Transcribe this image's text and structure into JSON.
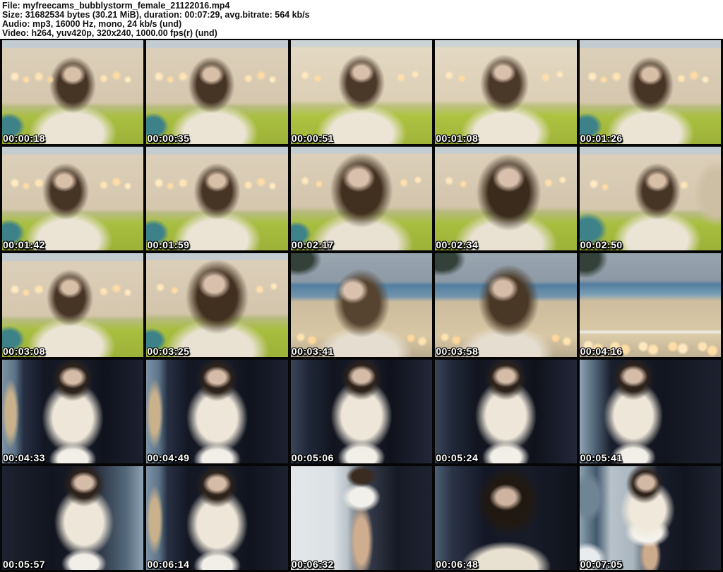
{
  "header": {
    "file_line": "File: myfreecams_bubblystorm_female_21122016.mp4",
    "size_line": "Size: 31682534 bytes (30.21 MiB), duration: 00:07:29, avg.bitrate: 564 kb/s",
    "audio_line": "Audio: mp3, 16000 Hz, mono, 24 kb/s (und)",
    "video_line": "Video: h264, yuv420p, 320x240, 1000.00 fps(r) (und)"
  },
  "colors": {
    "page_bg": "#ffffff",
    "grid_bg": "#060606",
    "timestamp_text": "#ffffff",
    "timestamp_outline": "#000000"
  },
  "thumbnails": [
    {
      "t": "00:00:18",
      "bg": "background:radial-gradient(circle 10px at 9% 35%,#ffeac2 30%,transparent 75%),radial-gradient(circle 8px at 17% 38%,#ffdca4 30%,transparent 75%),radial-gradient(circle 10px at 26% 35%,#ffe5b5 30%,transparent 75%),radial-gradient(circle 8px at 34% 38%,#f5d6a0 30%,transparent 75%),radial-gradient(circle 9px at 72% 37%,#ffe5b5 30%,transparent 75%),radial-gradient(circle 10px at 81% 34%,#ffdca4 30%,transparent 75%),radial-gradient(circle 8px at 89% 38%,#ffeac2 30%,transparent 75%),radial-gradient(ellipse 24px 20px at 50% 33%,#d8bfa8 45%,transparent 78%),radial-gradient(ellipse 46px 56px at 50% 43%,#463425 45%,transparent 72%),radial-gradient(ellipse 78px 52px at 50% 90%,#ebe4d5 55%,transparent 80%),radial-gradient(ellipse 28px 24px at 5% 83%,#3d8189 50%,transparent 80%),linear-gradient(180deg,#c3ccd1 0%,#c3ccd1 7%,#dccfb9 8%,#d5c7ae 60%,#b8bc80 64%,#a9bf40 74%,#9cb138 100%)"
    },
    {
      "t": "00:00:35",
      "bg": "background:radial-gradient(circle 10px at 9% 35%,#ffeac2 30%,transparent 75%),radial-gradient(circle 8px at 17% 38%,#ffdca4 30%,transparent 75%),radial-gradient(circle 10px at 26% 35%,#ffe5b5 30%,transparent 75%),radial-gradient(circle 9px at 72% 37%,#ffe5b5 30%,transparent 75%),radial-gradient(circle 10px at 81% 34%,#ffdca4 30%,transparent 75%),radial-gradient(circle 8px at 89% 38%,#ffeac2 30%,transparent 75%),radial-gradient(ellipse 24px 20px at 46% 33%,#d8bfa8 45%,transparent 78%),radial-gradient(ellipse 46px 56px at 46% 43%,#463425 45%,transparent 72%),radial-gradient(ellipse 78px 52px at 48% 90%,#ebe4d5 55%,transparent 80%),radial-gradient(ellipse 28px 24px at 5% 83%,#3d8189 50%,transparent 80%),linear-gradient(180deg,#c3ccd1 0%,#c3ccd1 7%,#dccfb9 8%,#d5c7ae 60%,#b8bc80 64%,#a9bf40 74%,#9cb138 100%)"
    },
    {
      "t": "00:00:51",
      "bg": "background:radial-gradient(circle 9px at 10% 34%,#ffe8bd 30%,transparent 75%),radial-gradient(circle 8px at 19% 37%,#ffdca4 30%,transparent 75%),radial-gradient(circle 9px at 78% 36%,#ffe0ac 30%,transparent 75%),radial-gradient(circle 8px at 88% 33%,#ffe8bd 30%,transparent 75%),radial-gradient(ellipse 24px 20px at 50% 31%,#d9c0ac 45%,transparent 78%),radial-gradient(ellipse 46px 56px at 50% 41%,#4a3828 45%,transparent 72%),radial-gradient(ellipse 80px 52px at 50% 90%,#ece5d6 55%,transparent 80%),linear-gradient(180deg,#cdd4d6 0%,#cdd4d6 6%,#e3d8c2 7%,#dccfb6 58%,#bec183 63%,#aec340 73%,#a0b43a 100%)"
    },
    {
      "t": "00:01:08",
      "bg": "background:radial-gradient(circle 9px at 10% 34%,#ffe8bd 30%,transparent 75%),radial-gradient(circle 8px at 19% 37%,#ffdca4 30%,transparent 75%),radial-gradient(circle 9px at 78% 36%,#ffe0ac 30%,transparent 75%),radial-gradient(circle 8px at 88% 33%,#ffe8bd 30%,transparent 75%),radial-gradient(ellipse 24px 20px at 48% 31%,#d9c0ac 45%,transparent 78%),radial-gradient(ellipse 48px 58px at 49% 42%,#4a3828 45%,transparent 72%),radial-gradient(ellipse 80px 52px at 50% 90%,#ece5d6 55%,transparent 80%),linear-gradient(180deg,#cdd4d6 0%,#cdd4d6 6%,#e3d8c2 7%,#dccfb6 58%,#bec183 63%,#aec340 73%,#a0b43a 100%)"
    },
    {
      "t": "00:01:26",
      "bg": "background:radial-gradient(circle 10px at 9% 35%,#ffeac2 30%,transparent 75%),radial-gradient(circle 8px at 17% 38%,#ffdca4 30%,transparent 75%),radial-gradient(circle 10px at 26% 35%,#ffe5b5 30%,transparent 75%),radial-gradient(circle 9px at 72% 37%,#ffe5b5 30%,transparent 75%),radial-gradient(circle 10px at 81% 34%,#ffdca4 30%,transparent 75%),radial-gradient(circle 8px at 89% 38%,#ffeac2 30%,transparent 75%),radial-gradient(ellipse 24px 20px at 50% 33%,#d8bfa8 45%,transparent 78%),radial-gradient(ellipse 46px 56px at 50% 43%,#463425 45%,transparent 72%),radial-gradient(ellipse 78px 52px at 50% 90%,#ebe4d5 55%,transparent 80%),radial-gradient(ellipse 28px 24px at 5% 83%,#3d8189 50%,transparent 80%),linear-gradient(180deg,#c3ccd1 0%,#c3ccd1 7%,#dccfb9 8%,#d5c7ae 60%,#b8bc80 64%,#a9bf40 74%,#9cb138 100%)"
    },
    {
      "t": "00:01:42",
      "bg": "background:radial-gradient(circle 10px at 9% 35%,#ffeac2 30%,transparent 75%),radial-gradient(circle 8px at 17% 38%,#ffdca4 30%,transparent 75%),radial-gradient(circle 10px at 26% 35%,#ffe5b5 30%,transparent 75%),radial-gradient(circle 9px at 72% 37%,#ffe5b5 30%,transparent 75%),radial-gradient(circle 10px at 81% 34%,#ffdca4 30%,transparent 75%),radial-gradient(circle 8px at 89% 38%,#ffeac2 30%,transparent 75%),radial-gradient(ellipse 24px 20px at 44% 33%,#d8bfa8 45%,transparent 78%),radial-gradient(ellipse 46px 56px at 45% 43%,#463425 45%,transparent 72%),radial-gradient(ellipse 78px 52px at 47% 90%,#ebe4d5 55%,transparent 80%),radial-gradient(ellipse 28px 24px at 5% 83%,#3d8189 50%,transparent 80%),linear-gradient(180deg,#c3ccd1 0%,#c3ccd1 7%,#dccfb9 8%,#d5c7ae 60%,#b8bc80 64%,#a9bf40 74%,#9cb138 100%)"
    },
    {
      "t": "00:01:59",
      "bg": "background:radial-gradient(circle 10px at 9% 35%,#ffeac2 30%,transparent 75%),radial-gradient(circle 8px at 17% 38%,#ffdca4 30%,transparent 75%),radial-gradient(circle 10px at 26% 35%,#ffe5b5 30%,transparent 75%),radial-gradient(circle 9px at 72% 37%,#ffe5b5 30%,transparent 75%),radial-gradient(circle 10px at 81% 34%,#ffdca4 30%,transparent 75%),radial-gradient(circle 8px at 89% 38%,#ffeac2 30%,transparent 75%),radial-gradient(ellipse 24px 20px at 50% 33%,#d8bfa8 45%,transparent 78%),radial-gradient(ellipse 46px 56px at 50% 43%,#463425 45%,transparent 72%),radial-gradient(ellipse 78px 52px at 50% 90%,#ebe4d5 55%,transparent 80%),radial-gradient(ellipse 28px 24px at 5% 83%,#3d8189 50%,transparent 80%),linear-gradient(180deg,#c3ccd1 0%,#c3ccd1 7%,#dccfb9 8%,#d5c7ae 60%,#b8bc80 64%,#a9bf40 74%,#9cb138 100%)"
    },
    {
      "t": "00:02:17",
      "bg": "background:radial-gradient(circle 9px at 10% 33%,#ffe8bd 30%,transparent 75%),radial-gradient(circle 8px at 20% 36%,#ffdca4 30%,transparent 75%),radial-gradient(circle 9px at 80% 35%,#ffe0ac 30%,transparent 75%),radial-gradient(circle 8px at 90% 32%,#ffe8bd 30%,transparent 75%),radial-gradient(ellipse 30px 26px at 48% 30%,#d9c0ac 45%,transparent 78%),radial-gradient(ellipse 62px 74px at 50% 42%,#41301f 45%,transparent 72%),radial-gradient(ellipse 92px 58px at 50% 94%,#e9e2d3 55%,transparent 80%),radial-gradient(ellipse 26px 22px at 4% 84%,#3d8189 50%,transparent 80%),linear-gradient(180deg,#c3ccd1 0%,#c3ccd1 6%,#dccfb9 7%,#d3c5ac 58%,#b5ba7c 63%,#a8be3f 74%,#9cb138 100%)"
    },
    {
      "t": "00:02:34",
      "bg": "background:radial-gradient(circle 9px at 10% 33%,#ffe8bd 30%,transparent 75%),radial-gradient(circle 8px at 20% 36%,#ffdca4 30%,transparent 75%),radial-gradient(circle 9px at 80% 35%,#ffe0ac 30%,transparent 75%),radial-gradient(circle 8px at 90% 32%,#ffe8bd 30%,transparent 75%),radial-gradient(ellipse 30px 26px at 52% 30%,#d9c0ac 45%,transparent 78%),radial-gradient(ellipse 64px 76px at 52% 44%,#3a2b1c 45%,transparent 72%),radial-gradient(ellipse 92px 58px at 50% 94%,#e9e2d3 55%,transparent 80%),linear-gradient(180deg,#c3ccd1 0%,#c3ccd1 6%,#dccfb9 7%,#d3c5ac 58%,#b5ba7c 63%,#a8be3f 74%,#9cb138 100%)"
    },
    {
      "t": "00:02:50",
      "bg": "background:radial-gradient(circle 10px at 10% 36%,#ffeac2 30%,transparent 75%),radial-gradient(circle 8px at 18% 39%,#ffdca4 30%,transparent 75%),radial-gradient(circle 9px at 74% 37%,#ffe5b5 30%,transparent 75%),radial-gradient(ellipse 24px 20px at 55% 33%,#d8bfa8 45%,transparent 78%),radial-gradient(ellipse 46px 56px at 55% 43%,#463425 45%,transparent 72%),radial-gradient(ellipse 78px 52px at 55% 90%,#ebe4d5 55%,transparent 80%),radial-gradient(ellipse 34px 30px at 6% 80%,#3d8189 50%,transparent 80%),radial-gradient(ellipse 40px 60px at 97% 45%,#cdbfa4 50%,transparent 80%),linear-gradient(180deg,#c3ccd1 0%,#c3ccd1 7%,#dccfb9 8%,#d5c7ae 60%,#b8bc80 64%,#a9bf40 74%,#9cb138 100%)"
    },
    {
      "t": "00:03:08",
      "bg": "background:radial-gradient(circle 10px at 9% 35%,#ffeac2 30%,transparent 75%),radial-gradient(circle 8px at 17% 38%,#ffdca4 30%,transparent 75%),radial-gradient(circle 10px at 26% 35%,#ffe5b5 30%,transparent 75%),radial-gradient(circle 9px at 72% 37%,#ffe5b5 30%,transparent 75%),radial-gradient(circle 10px at 81% 34%,#ffdca4 30%,transparent 75%),radial-gradient(circle 8px at 89% 38%,#ffeac2 30%,transparent 75%),radial-gradient(ellipse 24px 20px at 48% 33%,#d8bfa8 45%,transparent 78%),radial-gradient(ellipse 46px 56px at 48% 43%,#463425 45%,transparent 72%),radial-gradient(ellipse 78px 52px at 49% 90%,#ebe4d5 55%,transparent 80%),radial-gradient(ellipse 28px 24px at 5% 83%,#3d8189 50%,transparent 80%),linear-gradient(180deg,#c3ccd1 0%,#c3ccd1 7%,#dccfb9 8%,#d5c7ae 60%,#b8bc80 64%,#a9bf40 74%,#9cb138 100%)"
    },
    {
      "t": "00:03:25",
      "bg": "background:radial-gradient(circle 9px at 10% 33%,#ffe8bd 30%,transparent 75%),radial-gradient(circle 8px at 20% 36%,#ffdca4 30%,transparent 75%),radial-gradient(circle 9px at 80% 35%,#ffe0ac 30%,transparent 75%),radial-gradient(circle 8px at 90% 32%,#ffe8bd 30%,transparent 75%),radial-gradient(ellipse 30px 26px at 48% 30%,#d9c0ac 45%,transparent 78%),radial-gradient(ellipse 62px 74px at 50% 42%,#41301f 45%,transparent 72%),radial-gradient(ellipse 92px 58px at 50% 94%,#e9e2d3 55%,transparent 80%),radial-gradient(ellipse 26px 22px at 4% 84%,#3d8189 50%,transparent 80%),linear-gradient(180deg,#c3ccd1 0%,#c3ccd1 6%,#dccfb9 7%,#d3c5ac 58%,#b5ba7c 63%,#a8be3f 74%,#9cb138 100%)"
    },
    {
      "t": "00:03:41",
      "bg": "background:radial-gradient(circle 9px at 7% 81%,#ffe3b0 35%,transparent 75%),radial-gradient(circle 10px at 15% 84%,#ffd79a 35%,transparent 75%),radial-gradient(circle 9px at 85% 82%,#ffd79a 35%,transparent 75%),radial-gradient(circle 10px at 93% 85%,#ffe3b0 35%,transparent 75%),radial-gradient(ellipse 28px 24px at 44% 36%,#d9c1ae 45%,transparent 78%),radial-gradient(ellipse 56px 68px at 50% 48%,#564330 45%,transparent 72%),radial-gradient(ellipse 85px 48px at 52% 96%,#e5ddcf 55%,transparent 80%),radial-gradient(ellipse 42px 30px at 5% 6%,#33413a 50%,transparent 80%),linear-gradient(180deg,#99a5af 0%,#8d9aa6 27%,#527ea0 31%,#7495ad 42%,#ccbc9d 47%,#d8c7a4 80%,#baab8e 100%)"
    },
    {
      "t": "00:03:58",
      "bg": "background:radial-gradient(circle 9px at 7% 81%,#ffe3b0 35%,transparent 75%),radial-gradient(circle 10px at 15% 84%,#ffd79a 35%,transparent 75%),radial-gradient(circle 9px at 85% 82%,#ffd79a 35%,transparent 75%),radial-gradient(circle 10px at 93% 85%,#ffe3b0 35%,transparent 75%),radial-gradient(ellipse 28px 24px at 48% 34%,#d4bca9 45%,transparent 78%),radial-gradient(ellipse 60px 72px at 52% 46%,#4a3826 45%,transparent 72%),radial-gradient(ellipse 85px 48px at 50% 96%,#e5ddcf 55%,transparent 80%),radial-gradient(ellipse 42px 30px at 5% 6%,#33413a 50%,transparent 80%),linear-gradient(180deg,#99a5af 0%,#8d9aa6 27%,#527ea0 31%,#7495ad 42%,#ccbc9d 47%,#d8c7a4 80%,#baab8e 100%)"
    },
    {
      "t": "00:04:16",
      "bg": "background:radial-gradient(circle 11px at 6% 89%,#ffe9c0 40%,transparent 75%),radial-gradient(circle 12px at 13% 92%,#ffdda6 40%,transparent 75%),radial-gradient(circle 11px at 25% 90%,#ffe3b2 40%,transparent 75%),radial-gradient(circle 12px at 32% 93%,#ffdda6 40%,transparent 75%),radial-gradient(circle 11px at 45% 90%,#ffe9c0 40%,transparent 75%),radial-gradient(circle 12px at 52% 93%,#ffe3b2 40%,transparent 75%),radial-gradient(circle 11px at 66% 90%,#ffdda6 40%,transparent 75%),radial-gradient(circle 12px at 73% 92%,#ffe9c0 40%,transparent 75%),radial-gradient(circle 11px at 87% 90%,#ffe3b2 40%,transparent 75%),radial-gradient(circle 12px at 94% 94%,#ffdda6 40%,transparent 75%),linear-gradient(180deg,transparent 74%,#e9e5da 75%,#e9e5da 77%,transparent 78%),radial-gradient(ellipse 40px 35px at 4% 5%,#33413a 50%,transparent 80%),linear-gradient(180deg,#97a3ad 0%,#8c99a5 26%,#527ea0 30%,#7ba0b5 40%,#cdbd9e 46%,#dbcaa7 80%,#c0b194 100%)"
    },
    {
      "t": "00:04:33",
      "bg": "background:radial-gradient(ellipse 26px 20px at 50% 17%,#d5bca9 45%,transparent 78%),radial-gradient(ellipse 40px 42px at 50% 19%,#2e231b 45%,transparent 74%),radial-gradient(ellipse 56px 66px at 50% 56%,#eee7d9 50%,transparent 78%),radial-gradient(ellipse 42px 28px at 50% 96%,#f1efe8 50%,transparent 80%),radial-gradient(ellipse 16px 64px at 6% 52%,#c9b18b 45%,transparent 78%),linear-gradient(90deg,#7d92a5 0%,#5d7488 9%,#273043 15%,#131724 30%,#191d2a 55%,#10131d 72%,#1c2130 100%)"
    },
    {
      "t": "00:04:49",
      "bg": "background:radial-gradient(ellipse 26px 20px at 50% 17%,#d5bca9 45%,transparent 78%),radial-gradient(ellipse 40px 42px at 50% 19%,#2e231b 45%,transparent 74%),radial-gradient(ellipse 56px 66px at 50% 56%,#eee7d9 50%,transparent 78%),radial-gradient(ellipse 42px 28px at 50% 96%,#f1efe8 50%,transparent 80%),radial-gradient(ellipse 16px 64px at 6% 52%,#c9b18b 45%,transparent 78%),linear-gradient(90deg,#7d92a5 0%,#5d7488 9%,#273043 15%,#131724 30%,#191d2a 55%,#10131d 72%,#1c2130 100%)"
    },
    {
      "t": "00:05:06",
      "bg": "background:radial-gradient(ellipse 26px 20px at 50% 16%,#d5bca9 45%,transparent 78%),radial-gradient(ellipse 40px 42px at 50% 18%,#2e231b 45%,transparent 74%),radial-gradient(ellipse 56px 66px at 50% 54%,#eee7d9 50%,transparent 78%),radial-gradient(ellipse 42px 28px at 50% 94%,#f1efe8 50%,transparent 80%),linear-gradient(90deg,#3a4558 0%,#202839 12%,#12151f 30%,#1a1e2b 55%,#0f121b 70%,#222739 100%)"
    },
    {
      "t": "00:05:24",
      "bg": "background:radial-gradient(ellipse 26px 20px at 50% 16%,#d5bca9 45%,transparent 78%),radial-gradient(ellipse 40px 42px at 50% 18%,#2e231b 45%,transparent 74%),radial-gradient(ellipse 56px 66px at 50% 54%,#eee7d9 50%,transparent 78%),radial-gradient(ellipse 42px 28px at 50% 94%,#f1efe8 50%,transparent 80%),linear-gradient(90deg,#3a4558 0%,#202839 12%,#12151f 30%,#1a1e2b 55%,#0f121b 70%,#222739 100%)"
    },
    {
      "t": "00:05:41",
      "bg": "background:radial-gradient(ellipse 26px 20px at 38% 16%,#d5bca9 45%,transparent 78%),radial-gradient(ellipse 40px 42px at 38% 18%,#2e231b 45%,transparent 74%),radial-gradient(ellipse 54px 64px at 38% 54%,#eee7d9 50%,transparent 78%),radial-gradient(ellipse 40px 26px at 38% 94%,#f1efe8 50%,transparent 80%),linear-gradient(90deg,#8fa3b3 0%,#55697c 10%,#1a1f2d 22%,#12151f 60%,#1d2230 100%)"
    },
    {
      "t": "00:05:57",
      "bg": "background:radial-gradient(ellipse 26px 20px at 58% 16%,#d5bca9 45%,transparent 78%),radial-gradient(ellipse 40px 42px at 58% 18%,#2e231b 45%,transparent 74%),radial-gradient(ellipse 54px 64px at 58% 54%,#eee7d9 50%,transparent 78%),radial-gradient(ellipse 40px 26px at 58% 94%,#f1efe8 50%,transparent 80%),linear-gradient(90deg,#1d2230 0%,#12151f 35%,#1a1e2b 60%,#55697c 88%,#8fa3b3 100%)"
    },
    {
      "t": "00:06:14",
      "bg": "background:radial-gradient(ellipse 26px 20px at 50% 17%,#d5bca9 45%,transparent 78%),radial-gradient(ellipse 40px 42px at 50% 19%,#2e231b 45%,transparent 74%),radial-gradient(ellipse 56px 66px at 50% 56%,#eee7d9 50%,transparent 78%),radial-gradient(ellipse 42px 28px at 50% 96%,#f1efe8 50%,transparent 80%),radial-gradient(ellipse 16px 64px at 6% 52%,#c9b18b 45%,transparent 78%),linear-gradient(90deg,#7d92a5 0%,#5d7488 9%,#273043 15%,#131724 30%,#191d2a 55%,#10131d 72%,#1c2130 100%)"
    },
    {
      "t": "00:06:32",
      "bg": "background:radial-gradient(ellipse 30px 20px at 50% 10%,#3a2c20 45%,transparent 75%),radial-gradient(ellipse 34px 26px at 50% 30%,#f2f0ea 50%,transparent 80%),radial-gradient(ellipse 22px 70px at 50% 72%,#cfae90 45%,transparent 78%),linear-gradient(90deg,#e3e7ea 0%,#dce1e4 30%,#b9c3c9 40%,#39404f 52%,#161a26 75%,#1e2331 100%)"
    },
    {
      "t": "00:06:48",
      "bg": "background:radial-gradient(ellipse 30px 24px at 50% 30%,#cdb3a0 45%,transparent 78%),radial-gradient(ellipse 64px 70px at 52% 34%,#211911 45%,transparent 72%),radial-gradient(ellipse 80px 45px at 50% 97%,#e8e1d2 55%,transparent 80%),linear-gradient(90deg,#4e6175 0%,#2a3345 12%,#141826 35%,#181c29 65%,#10131c 100%)"
    },
    {
      "t": "00:07:05",
      "bg": "background:radial-gradient(ellipse 24px 20px at 47% 16%,#d2b9a6 45%,transparent 78%),radial-gradient(ellipse 36px 38px at 46% 17%,#2e231b 45%,transparent 74%),radial-gradient(ellipse 50px 55px at 48% 42%,#f0e9db 50%,transparent 78%),radial-gradient(ellipse 40px 26px at 48% 64%,#f4f2ec 50%,transparent 80%),radial-gradient(ellipse 20px 40px at 50% 86%,#cdab8d 45%,transparent 78%),radial-gradient(ellipse 30px 45px at 6% 30%,#6f8495 50%,transparent 80%),radial-gradient(ellipse 35px 30px at 5% 90%,#e8ecee 50%,transparent 80%),linear-gradient(90deg,#8da2b2 0%,#42586c 12%,#b7c2ca 22%,#aab6bf 38%,#1a1e2c 55%,#12151f 75%,#1f2433 100%)"
    }
  ]
}
